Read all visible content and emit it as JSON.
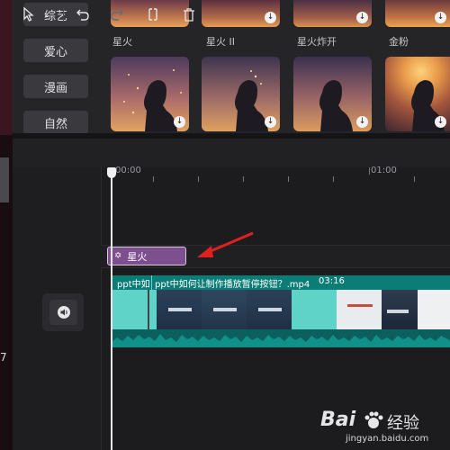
{
  "categories": [
    "综艺",
    "爱心",
    "漫画",
    "自然"
  ],
  "effects": [
    {
      "label": "星火"
    },
    {
      "label": "星火 II"
    },
    {
      "label": "星火炸开"
    },
    {
      "label": "金粉"
    }
  ],
  "timeline": {
    "ruler": [
      "00:00",
      "01:00"
    ],
    "effect_clip_label": "星火",
    "video_clip": {
      "name_left": "ppt中如",
      "name": "ppt中如何让制作播放暂停按钮？.mp4",
      "duration": "03:16"
    }
  },
  "left_edge_digit": "7",
  "watermark": {
    "brand": "Bai",
    "brand_cn": "经验",
    "url": "jingyan.baidu.com"
  },
  "colors": {
    "effect_clip": "#7e4f8e",
    "video_clip": "#0c7c77",
    "annotation_arrow": "#e02020"
  }
}
